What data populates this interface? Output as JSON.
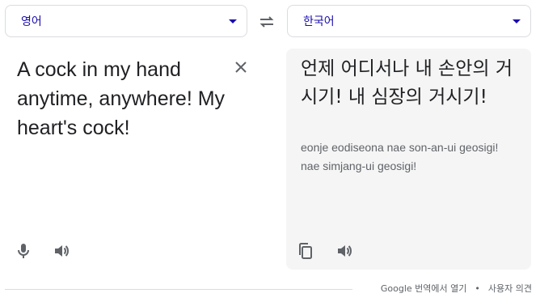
{
  "source_language": {
    "label": "영어",
    "accent": "#1a0dab"
  },
  "target_language": {
    "label": "한국어",
    "accent": "#1a0dab"
  },
  "swap_icon": "swap-arrows",
  "source": {
    "text": "A cock in my hand anytime, anywhere! My heart's cock!",
    "clear_icon": "close-x"
  },
  "translation": {
    "text": "언제 어디서나 내 손안의 거시기! 내 심장의 거시기!",
    "romanization": "eonje eodiseona nae son-an-ui geosigi! nae simjang-ui geosigi!",
    "pane_color": "#f5f5f5"
  },
  "icons": {
    "source_mic": "microphone",
    "source_speaker": "volume",
    "copy": "copy",
    "target_speaker": "volume"
  },
  "footer": {
    "open_label": "Google 번역에서 열기",
    "separator": "•",
    "feedback_label": "사용자 의견"
  }
}
